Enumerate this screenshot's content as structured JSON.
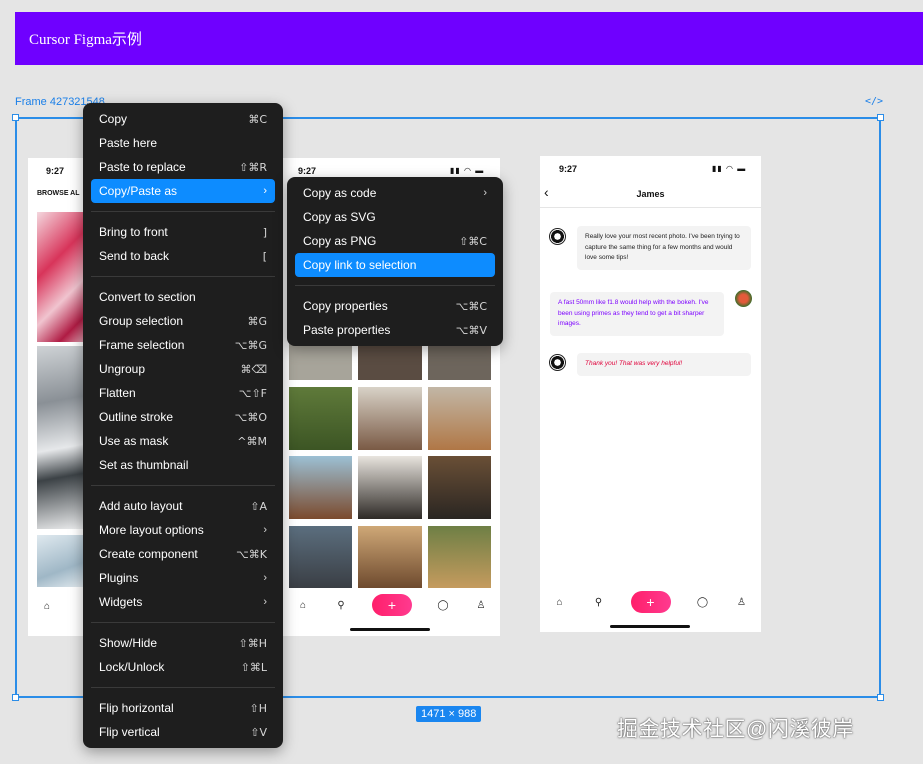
{
  "banner": {
    "title": "Cursor Figma示例"
  },
  "canvas": {
    "frame_label": "Frame 427321548",
    "code_tag": "</>",
    "size_badge": "1471 × 988"
  },
  "phone1": {
    "time": "9:27",
    "browse_label": "BROWSE AL"
  },
  "phone2": {
    "time": "9:27"
  },
  "phone3": {
    "time": "9:27",
    "chat_title": "James",
    "messages": [
      {
        "text": "Really love your most recent photo. I've been trying to capture the same thing for a few months and would love some tips!"
      },
      {
        "text": "A fast 50mm like f1.8 would help with the bokeh. I've been using primes as they tend to get a bit sharper images."
      },
      {
        "text": "Thank you! That was very helpful!"
      }
    ]
  },
  "context_menu": {
    "items": [
      {
        "label": "Copy",
        "shortcut": "⌘C"
      },
      {
        "label": "Paste here",
        "shortcut": ""
      },
      {
        "label": "Paste to replace",
        "shortcut": "⇧⌘R"
      },
      {
        "label": "Copy/Paste as",
        "shortcut": "›"
      },
      {
        "label": "Bring to front",
        "shortcut": "]"
      },
      {
        "label": "Send to back",
        "shortcut": "["
      },
      {
        "label": "Convert to section",
        "shortcut": ""
      },
      {
        "label": "Group selection",
        "shortcut": "⌘G"
      },
      {
        "label": "Frame selection",
        "shortcut": "⌥⌘G"
      },
      {
        "label": "Ungroup",
        "shortcut": "⌘⌫"
      },
      {
        "label": "Flatten",
        "shortcut": "⌥⇧F"
      },
      {
        "label": "Outline stroke",
        "shortcut": "⌥⌘O"
      },
      {
        "label": "Use as mask",
        "shortcut": "^⌘M"
      },
      {
        "label": "Set as thumbnail",
        "shortcut": ""
      },
      {
        "label": "Add auto layout",
        "shortcut": "⇧A"
      },
      {
        "label": "More layout options",
        "shortcut": "›"
      },
      {
        "label": "Create component",
        "shortcut": "⌥⌘K"
      },
      {
        "label": "Plugins",
        "shortcut": "›"
      },
      {
        "label": "Widgets",
        "shortcut": "›"
      },
      {
        "label": "Show/Hide",
        "shortcut": "⇧⌘H"
      },
      {
        "label": "Lock/Unlock",
        "shortcut": "⇧⌘L"
      },
      {
        "label": "Flip horizontal",
        "shortcut": "⇧H"
      },
      {
        "label": "Flip vertical",
        "shortcut": "⇧V"
      }
    ]
  },
  "submenu": {
    "items": [
      {
        "label": "Copy as code",
        "shortcut": "›"
      },
      {
        "label": "Copy as SVG",
        "shortcut": ""
      },
      {
        "label": "Copy as PNG",
        "shortcut": "⇧⌘C"
      },
      {
        "label": "Copy link to selection",
        "shortcut": ""
      },
      {
        "label": "Copy properties",
        "shortcut": "⌥⌘C"
      },
      {
        "label": "Paste properties",
        "shortcut": "⌥⌘V"
      }
    ]
  },
  "watermark": "掘金技术社区@闪溪彼岸",
  "colors": {
    "accent": "#0d8cff",
    "banner": "#6f00ff",
    "selection": "#2b8de8"
  }
}
